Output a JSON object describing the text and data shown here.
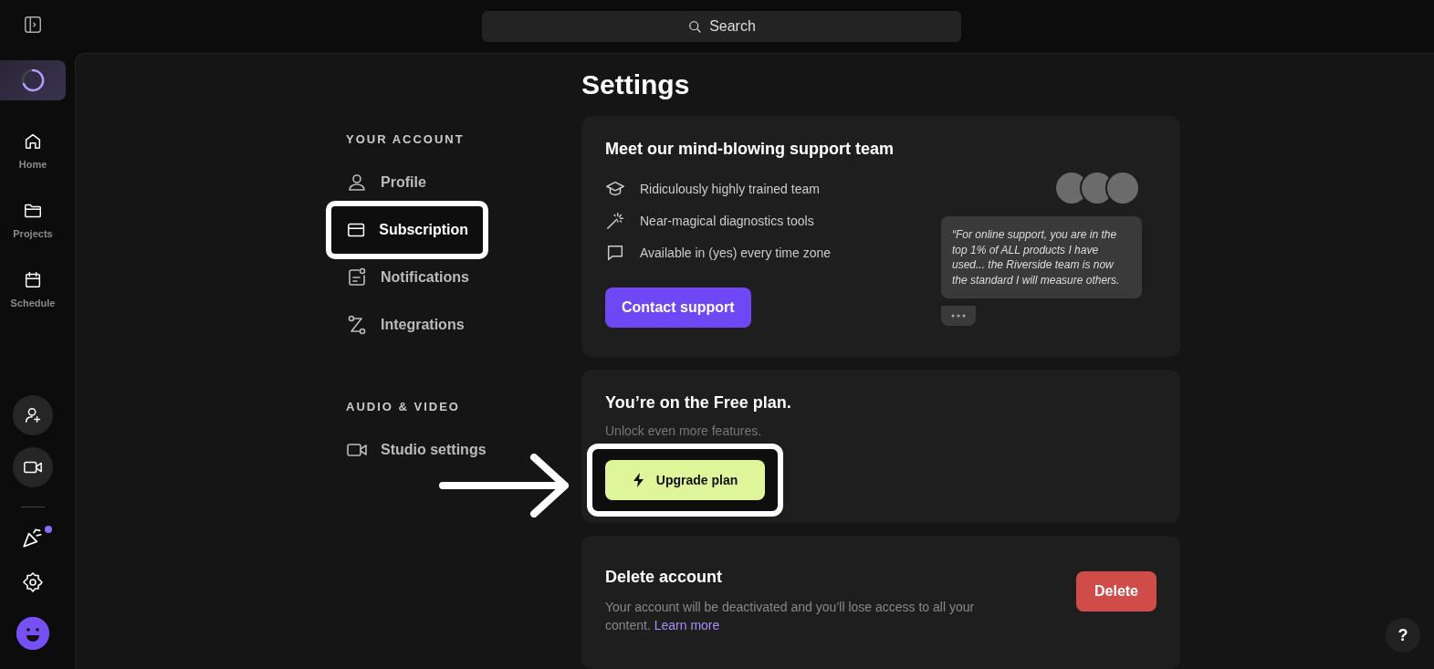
{
  "search": {
    "placeholder": "Search"
  },
  "rail": {
    "items": [
      {
        "label": "Home"
      },
      {
        "label": "Projects"
      },
      {
        "label": "Schedule"
      }
    ],
    "whats_new": {
      "unread": true
    }
  },
  "title": "Settings",
  "nav": {
    "sections": [
      {
        "heading": "YOUR ACCOUNT",
        "items": [
          {
            "label": "Profile",
            "selected": false
          },
          {
            "label": "Subscription",
            "selected": true
          },
          {
            "label": "Notifications",
            "selected": false
          },
          {
            "label": "Integrations",
            "selected": false
          }
        ]
      },
      {
        "heading": "AUDIO & VIDEO",
        "items": [
          {
            "label": "Studio settings",
            "selected": false
          }
        ]
      }
    ]
  },
  "support_card": {
    "title": "Meet our mind-blowing support team",
    "features": [
      "Ridiculously highly trained team",
      "Near-magical diagnostics tools",
      "Available in (yes) every time zone"
    ],
    "button": "Contact support",
    "quote": "“For online support, you are in the top 1% of ALL products I have used... the Riverside team is now the standard I will measure others."
  },
  "plan_card": {
    "title": "You’re on the Free plan.",
    "subtitle": "Unlock even more features.",
    "button": "Upgrade plan",
    "highlighted": true
  },
  "delete_card": {
    "title": "Delete account",
    "text": "Your account will be deactivated and you’ll lose access to all your content.",
    "link": "Learn more",
    "button": "Delete"
  },
  "help_button": "?"
}
